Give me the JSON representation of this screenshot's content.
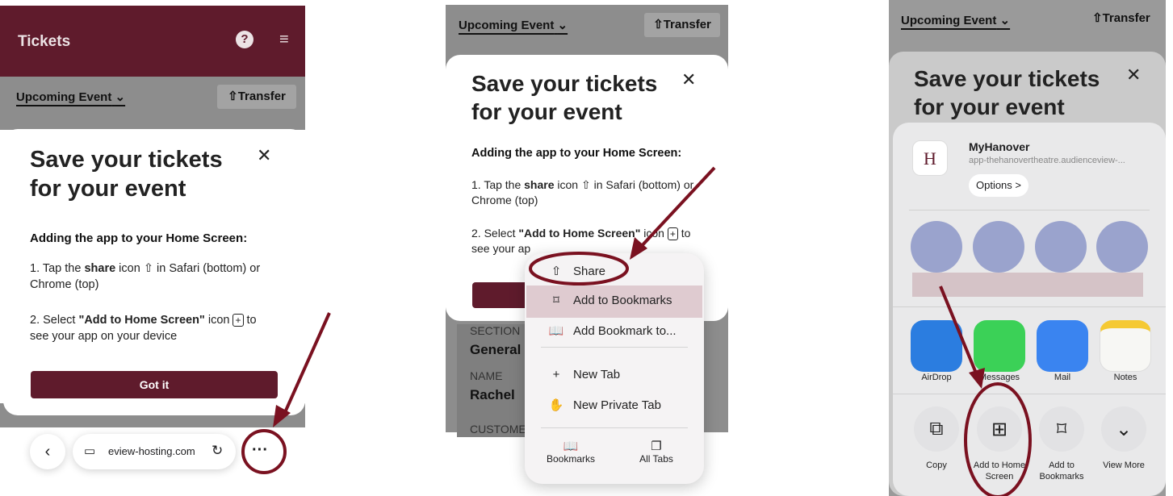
{
  "colors": {
    "brand": "#5f1b2c",
    "annotation": "#7a1120"
  },
  "header": {
    "title": "Tickets",
    "help_icon": "help-icon",
    "menu_icon": "hamburger-menu-icon"
  },
  "event": {
    "selector_label": "Upcoming Event",
    "transfer_label": "Transfer"
  },
  "modal": {
    "title_line1": "Save your tickets",
    "title_line2": "for your event",
    "subtitle": "Adding the app to your Home Screen:",
    "step1_pre": "1. Tap the ",
    "step1_bold": "share",
    "step1_mid": " icon ",
    "step1_post": " in Safari (bottom) or",
    "step1_line2": "Chrome (top)",
    "step2_pre": "2. Select ",
    "step2_bold": "\"Add to Home Screen\"",
    "step2_mid": " icon ",
    "step2_post": " to",
    "step2_line2": "see your app on your device",
    "button": "Got it"
  },
  "browser": {
    "url": "eview-hosting.com"
  },
  "p2": {
    "step1_post_short": " in Safari (botto",
    "step1_tail": "m) or",
    "step2_bold_short": "\"Add to Home Screen\"",
    "step2_post": " icon ",
    "step2_tail": " to",
    "step2_line2": "see your ap",
    "ticket_fields": [
      {
        "label": "SECTION",
        "value": "General"
      },
      {
        "label": "NAME",
        "value": "Rachel"
      },
      {
        "label": "CUSTOME",
        "value": ""
      }
    ]
  },
  "menu": {
    "items": [
      {
        "label": "Share",
        "icon": "share-icon",
        "glyph": "⇧"
      },
      {
        "label": "Add to Bookmarks",
        "icon": "bookmark-icon",
        "glyph": "⌑"
      },
      {
        "label": "Add Bookmark to...",
        "icon": "book-icon",
        "glyph": "📖"
      },
      {
        "label": "New Tab",
        "icon": "plus-icon",
        "glyph": "+"
      },
      {
        "label": "New Private Tab",
        "icon": "hand-icon",
        "glyph": "✋"
      }
    ],
    "bottom": [
      {
        "label": "Bookmarks",
        "icon": "bookmarks-icon"
      },
      {
        "label": "All Tabs",
        "icon": "tabs-icon"
      }
    ]
  },
  "share": {
    "app_name": "MyHanover",
    "app_url": "app-thehanovertheatre.audienceview-...",
    "app_letter": "H",
    "options_label": "Options >",
    "apps": [
      {
        "label": "AirDrop",
        "color": "#2b7de0"
      },
      {
        "label": "Messages",
        "color": "#3bd157"
      },
      {
        "label": "Mail",
        "color": "#3a84f0"
      },
      {
        "label": "Notes",
        "color": "#f7f7f4"
      }
    ],
    "actions": [
      {
        "label_line1": "Copy",
        "label_line2": "",
        "icon": "copy-icon",
        "glyph": "⧉"
      },
      {
        "label_line1": "Add to Home",
        "label_line2": "Screen",
        "icon": "add-square-icon",
        "glyph": "⊞"
      },
      {
        "label_line1": "Add to",
        "label_line2": "Bookmarks",
        "icon": "bookmark-icon",
        "glyph": "⌑"
      },
      {
        "label_line1": "View More",
        "label_line2": "",
        "icon": "chevron-down-icon",
        "glyph": "⌄"
      }
    ]
  }
}
